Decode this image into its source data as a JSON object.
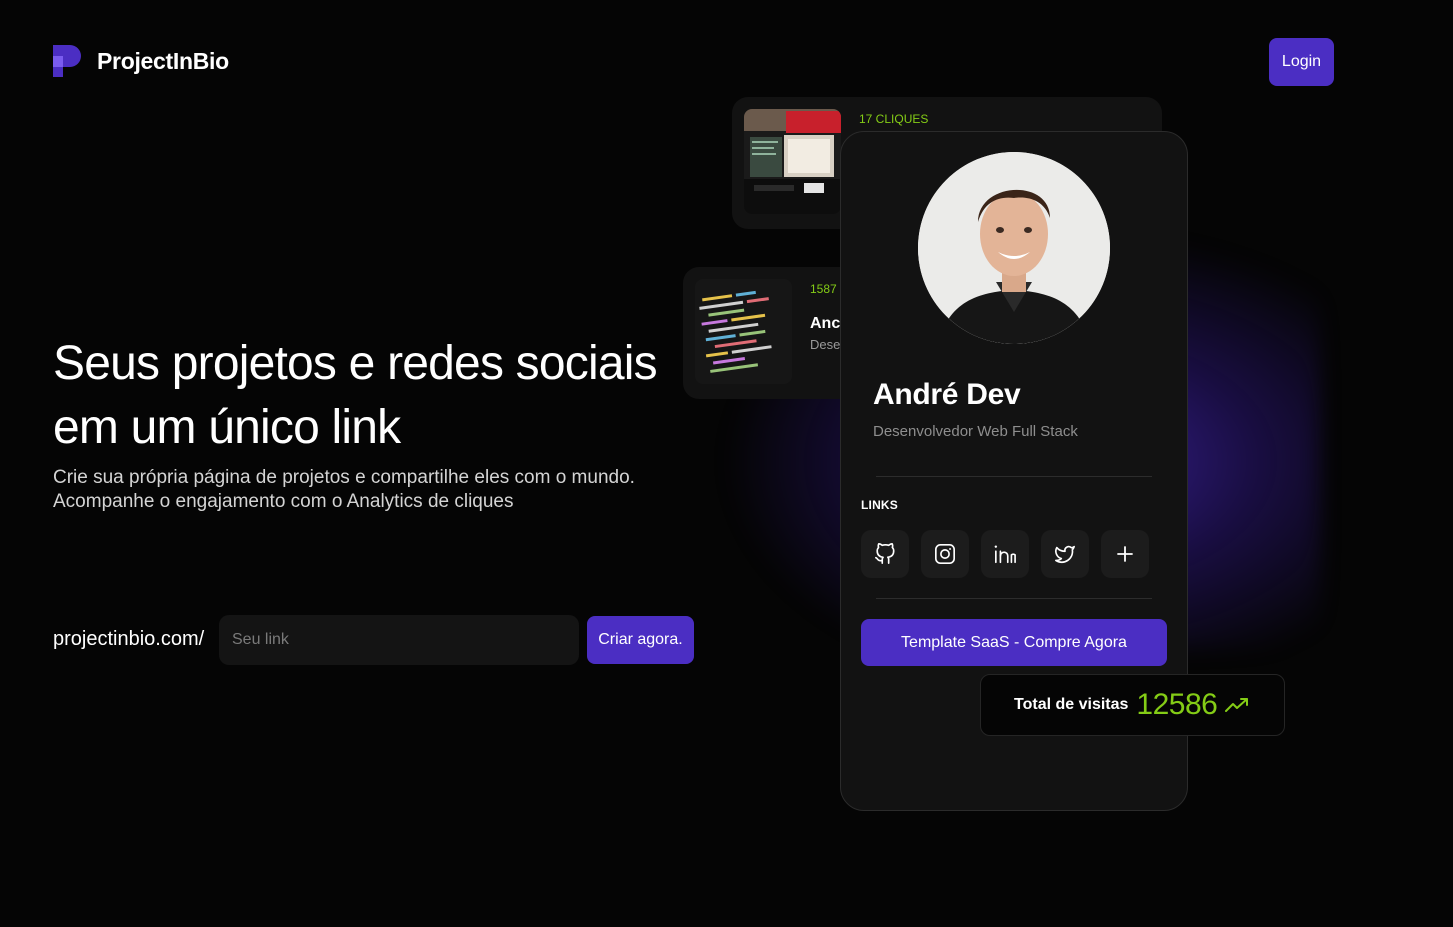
{
  "brand": {
    "name": "ProjectInBio",
    "accent": "#4b2ec3",
    "green": "#84cc16"
  },
  "header": {
    "login_label": "Login"
  },
  "hero": {
    "title": "Seus projetos e redes sociais em um único link",
    "subtitle_line1": "Crie sua própria página de projetos e compartilhe eles com o mundo.",
    "subtitle_line2": "Acompanhe o engajamento com o Analytics de cliques"
  },
  "link_form": {
    "prefix": "projectinbio.com/",
    "input_placeholder": "Seu link",
    "input_value": "",
    "submit_label": "Criar agora."
  },
  "projects": [
    {
      "clicks": "17 CLIQUES",
      "name": "",
      "description": ""
    },
    {
      "clicks": "1587",
      "name": "Anc",
      "description": "Dese"
    }
  ],
  "profile": {
    "name": "André Dev",
    "role": "Desenvolvedor Web Full Stack",
    "links_label": "LINKS",
    "socials": [
      "github-icon",
      "instagram-icon",
      "linkedin-icon",
      "twitter-icon",
      "plus-icon"
    ],
    "cta_label": "Template SaaS - Compre Agora"
  },
  "visits": {
    "label": "Total de visitas",
    "value": "12586",
    "trend_icon": "trending-up-icon"
  }
}
